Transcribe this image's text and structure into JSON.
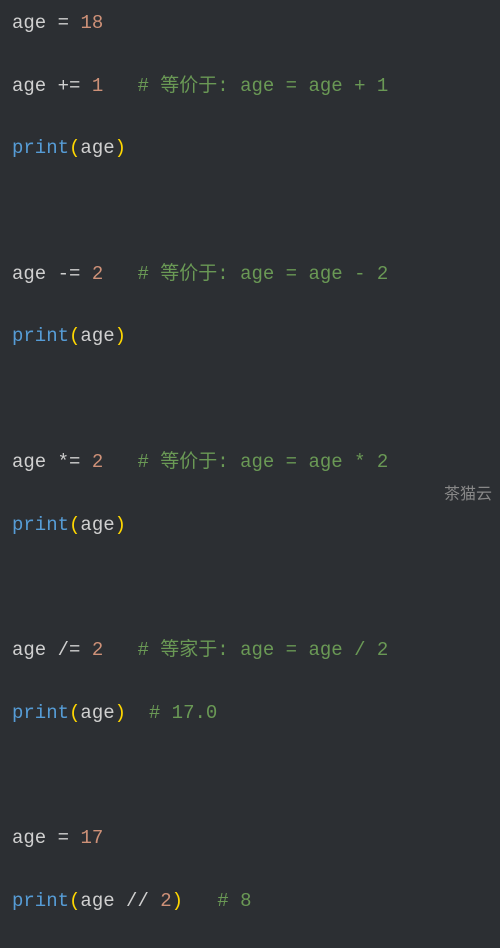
{
  "code": {
    "l1": {
      "var": "age",
      "op": "=",
      "num": "18"
    },
    "l2": {
      "var": "age",
      "op": "+=",
      "num": "1",
      "comment": "# 等价于: age = age + 1"
    },
    "l3": {
      "func": "print",
      "arg": "age",
      "lp": "(",
      "rp": ")"
    },
    "l5": {
      "var": "age",
      "op": "-=",
      "num": "2",
      "comment": "# 等价于: age = age - 2"
    },
    "l6": {
      "func": "print",
      "arg": "age",
      "lp": "(",
      "rp": ")"
    },
    "l8": {
      "var": "age",
      "op": "*=",
      "num": "2",
      "comment": "# 等价于: age = age * 2"
    },
    "l9": {
      "func": "print",
      "arg": "age",
      "lp": "(",
      "rp": ")"
    },
    "l11": {
      "var": "age",
      "op": "/=",
      "num": "2",
      "comment": "# 等家于: age = age / 2"
    },
    "l12": {
      "func": "print",
      "arg": "age",
      "lp": "(",
      "rp": ")",
      "comment": "# 17.0"
    },
    "l14": {
      "var": "age",
      "op": "=",
      "num": "17"
    },
    "l15": {
      "func": "print",
      "arg1": "age",
      "op": "//",
      "arg2": "2",
      "lp": "(",
      "rp": ")",
      "comment": "# 8"
    }
  },
  "watermark": "茶猫云"
}
